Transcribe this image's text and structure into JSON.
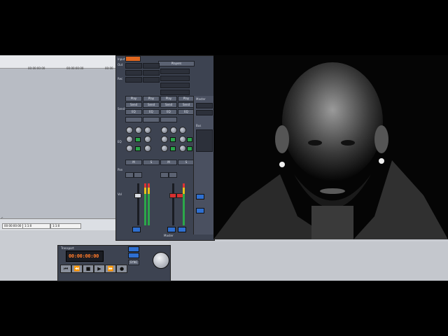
{
  "track_panel": {
    "header_cells": [
      "00:00:00:00",
      "00:00:00:00",
      "00:00"
    ],
    "footer_left": "00:00:00:00",
    "footer_mid": "1:1:0",
    "footer_right": "1:1:0",
    "side_marker": "S"
  },
  "mixer": {
    "section_labels": [
      "Input",
      "Out",
      "Rec",
      "Send",
      "EQ",
      "Pan",
      "Vol"
    ],
    "top_buttons": [
      "Players"
    ],
    "play_buttons": [
      "Play",
      "Play",
      "Play",
      "Play"
    ],
    "send_buttons": [
      "Send",
      "Send",
      "Send",
      "Send"
    ],
    "eq_buttons": [
      "EQ",
      "EQ",
      "EQ",
      "EQ"
    ],
    "mute_solo": [
      "M",
      "S",
      "M",
      "S"
    ],
    "side_labels": [
      "Master",
      "Bus"
    ],
    "bottom_label": "Master"
  },
  "transport": {
    "title": "Transport",
    "time": "00:00:00:00",
    "buttons": [
      "rewind",
      "back",
      "stop",
      "play",
      "forward",
      "record"
    ],
    "mode_label": "SYNC"
  },
  "photo": {
    "subject": ""
  },
  "colors": {
    "panel_bg": "#3d4351",
    "accent_orange": "#e0671f",
    "lcd_text": "#ff7a2a",
    "led_green": "#2aa54a",
    "button_blue": "#2f6fd0"
  }
}
